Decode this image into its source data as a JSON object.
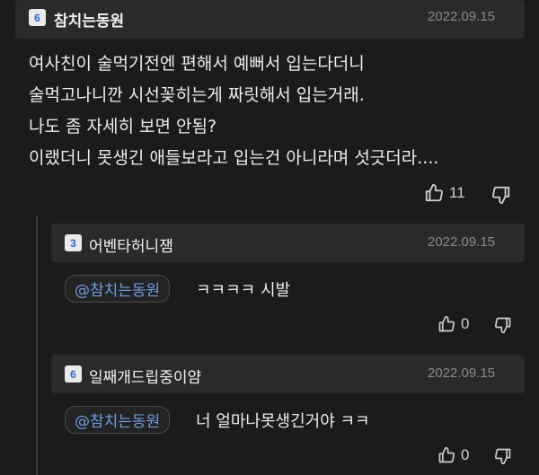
{
  "comment": {
    "badge": "6",
    "nickname": "참치는동원",
    "date": "2022.09.15",
    "lines": [
      "여사친이 술먹기전엔 편해서 예뻐서 입는다더니",
      "술먹고나니깐 시선꽂히는게 짜릿해서 입는거래.",
      "나도 좀 자세히 보면 안됨?",
      "이랬더니 못생긴 애들보라고 입는건 아니라며 섯긋더라...."
    ],
    "likes": "11"
  },
  "replies": [
    {
      "badge": "3",
      "nickname": "어벤타허니잼",
      "date": "2022.09.15",
      "mention": "@참치는동원",
      "text": "ㅋㅋㅋㅋ 시발",
      "likes": "0"
    },
    {
      "badge": "6",
      "nickname": "일째개드립중이얌",
      "date": "2022.09.15",
      "mention": "@참치는동원",
      "text": "너 얼마나못생긴거야 ㅋㅋ",
      "likes": "0"
    }
  ]
}
